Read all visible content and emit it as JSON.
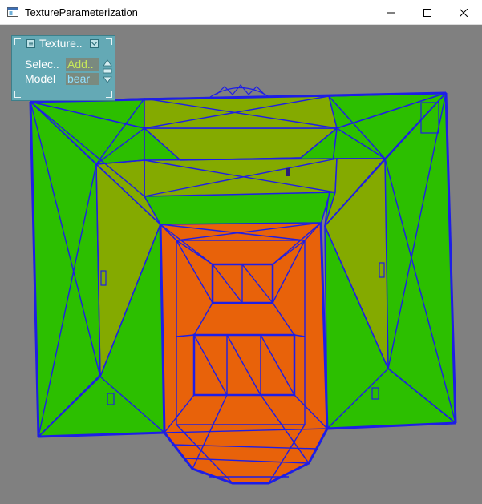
{
  "window": {
    "title": "TextureParameterization",
    "icon": "app-window-icon",
    "minimize_icon": "minimize-icon",
    "maximize_icon": "maximize-icon",
    "close_icon": "close-icon"
  },
  "panel": {
    "title": "Texture..",
    "collapse_icon": "chevron-down-icon",
    "menu_icon": "panel-menu-icon",
    "rows": [
      {
        "label": "Selec..",
        "value": "Add..",
        "value_color": "#c6e85a"
      },
      {
        "label": "Model",
        "value": "bear",
        "value_color": "#8fe0ff"
      }
    ],
    "spinner_icon": "spinner-arrows-icon"
  },
  "help": {
    "label": "?",
    "icon": "help-icon"
  },
  "colors": {
    "background": "#808080",
    "panel": "#64a9b5",
    "mesh_edge": "#1e1ee6",
    "face_green": "#2cbf00",
    "face_olive": "#84aa00",
    "face_orange": "#e8620a"
  }
}
